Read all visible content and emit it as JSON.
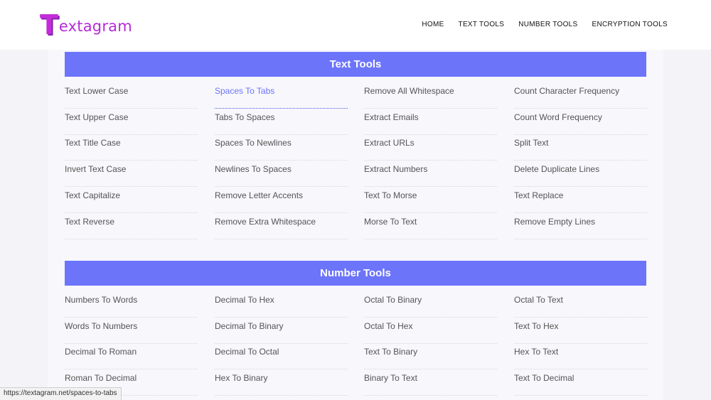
{
  "logo": {
    "first_letter": "T",
    "rest": "extagram"
  },
  "nav": [
    "HOME",
    "TEXT TOOLS",
    "NUMBER TOOLS",
    "ENCRYPTION TOOLS"
  ],
  "sections": [
    {
      "title": "Text Tools",
      "columns": [
        [
          "Text Lower Case",
          "Text Upper Case",
          "Text Title Case",
          "Invert Text Case",
          "Text Capitalize",
          "Text Reverse"
        ],
        [
          "Spaces To Tabs",
          "Tabs To Spaces",
          "Spaces To Newlines",
          "Newlines To Spaces",
          "Remove Letter Accents",
          "Remove Extra Whitespace"
        ],
        [
          "Remove All Whitespace",
          "Extract Emails",
          "Extract URLs",
          "Extract Numbers",
          "Text To Morse",
          "Morse To Text"
        ],
        [
          "Count Character Frequency",
          "Count Word Frequency",
          "Split Text",
          "Delete Duplicate Lines",
          "Text Replace",
          "Remove Empty Lines"
        ]
      ],
      "active": "Spaces To Tabs"
    },
    {
      "title": "Number Tools",
      "columns": [
        [
          "Numbers To Words",
          "Words To Numbers",
          "Decimal To Roman",
          "Roman To Decimal"
        ],
        [
          "Decimal To Hex",
          "Decimal To Binary",
          "Decimal To Octal",
          "Hex To Binary"
        ],
        [
          "Octal To Binary",
          "Octal To Hex",
          "Text To Binary",
          "Binary To Text"
        ],
        [
          "Octal To Text",
          "Text To Hex",
          "Hex To Text",
          "Text To Decimal"
        ]
      ]
    }
  ],
  "status_url": "https://textagram.net/spaces-to-tabs",
  "colors": {
    "accent": "#6c74fa",
    "logo": "#c22dd9",
    "header_bg": "#ffffff",
    "page_bg": "#f3f3f8"
  }
}
